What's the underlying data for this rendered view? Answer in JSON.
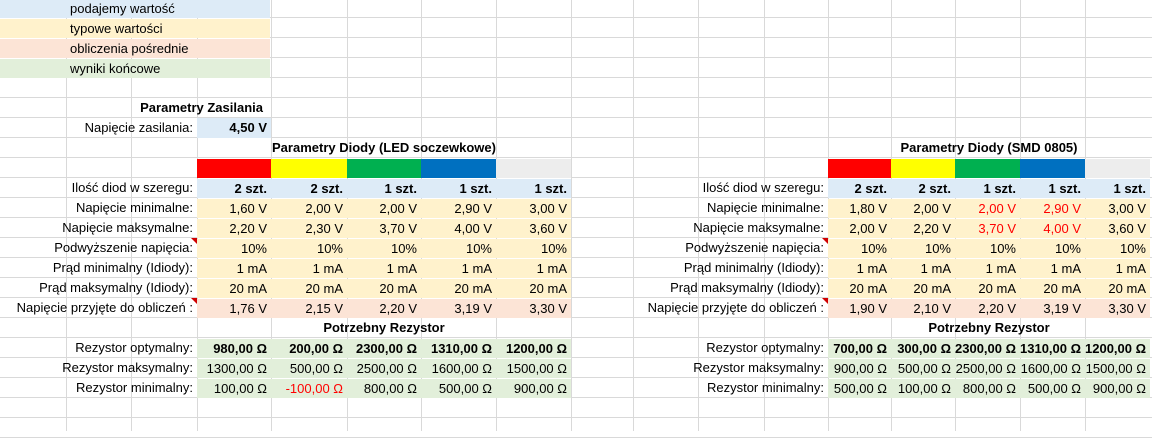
{
  "colors": {
    "input": "#ddebf7",
    "typical": "#fff2cc",
    "intermediate": "#fce4d6",
    "result": "#e2efda",
    "error_text": "#ff0000",
    "diode_swatches": [
      "#ff0000",
      "#ffff00",
      "#00b050",
      "#0070c0",
      "#ededed"
    ]
  },
  "legend": [
    {
      "label": "podajemy wartość"
    },
    {
      "label": "typowe wartości"
    },
    {
      "label": "obliczenia pośrednie"
    },
    {
      "label": "wyniki końcowe"
    }
  ],
  "power": {
    "title": "Parametry Zasilania",
    "voltage_label": "Napięcie zasilania:",
    "voltage_value": "4,50 V"
  },
  "row_labels": {
    "count": "Ilość diod w szeregu:",
    "vmin": "Napięcie minimalne:",
    "vmax": "Napięcie maksymalne:",
    "raise": "Podwyższenie napięcia:",
    "imin": "Prąd minimalny (Idiody):",
    "imax": "Prąd maksymalny (Idiody):",
    "vcalc": "Napięcie przyjęte do obliczeń :",
    "ropt": "Rezystor optymalny:",
    "rmax": "Rezystor maksymalny:",
    "rmin": "Rezystor minimalny:"
  },
  "resistor_title": "Potrzebny Rezystor",
  "tables": [
    {
      "title": "Parametry Diody (LED soczewkowe)",
      "count": [
        "2 szt.",
        "2 szt.",
        "1 szt.",
        "1 szt.",
        "1 szt."
      ],
      "vmin": [
        "1,60 V",
        "2,00 V",
        "2,00 V",
        "2,90 V",
        "3,00 V"
      ],
      "vmax": [
        "2,20 V",
        "2,30 V",
        "3,70 V",
        "4,00 V",
        "3,60 V"
      ],
      "raise": [
        "10%",
        "10%",
        "10%",
        "10%",
        "10%"
      ],
      "imin": [
        "1 mA",
        "1 mA",
        "1 mA",
        "1 mA",
        "1 mA"
      ],
      "imax": [
        "20 mA",
        "20 mA",
        "20 mA",
        "20 mA",
        "20 mA"
      ],
      "vcalc": [
        "1,76 V",
        "2,15 V",
        "2,20 V",
        "3,19 V",
        "3,30 V"
      ],
      "ropt": [
        "980,00 Ω",
        "200,00 Ω",
        "2300,00 Ω",
        "1310,00 Ω",
        "1200,00 Ω"
      ],
      "rmax": [
        "1300,00 Ω",
        "500,00 Ω",
        "2500,00 Ω",
        "1600,00 Ω",
        "1500,00 Ω"
      ],
      "rmin": [
        "100,00 Ω",
        "-100,00 Ω",
        "800,00 Ω",
        "500,00 Ω",
        "900,00 Ω"
      ]
    },
    {
      "title": "Parametry Diody (SMD 0805)",
      "count": [
        "2 szt.",
        "2 szt.",
        "1 szt.",
        "1 szt.",
        "1 szt."
      ],
      "vmin": [
        "1,80 V",
        "2,00 V",
        "2,00 V",
        "2,90 V",
        "3,00 V"
      ],
      "vmax": [
        "2,00 V",
        "2,20 V",
        "3,70 V",
        "4,00 V",
        "3,60 V"
      ],
      "raise": [
        "10%",
        "10%",
        "10%",
        "10%",
        "10%"
      ],
      "imin": [
        "1 mA",
        "1 mA",
        "1 mA",
        "1 mA",
        "1 mA"
      ],
      "imax": [
        "20 mA",
        "20 mA",
        "20 mA",
        "20 mA",
        "20 mA"
      ],
      "vcalc": [
        "1,90 V",
        "2,10 V",
        "2,20 V",
        "3,19 V",
        "3,30 V"
      ],
      "ropt": [
        "700,00 Ω",
        "300,00 Ω",
        "2300,00 Ω",
        "1310,00 Ω",
        "1200,00 Ω"
      ],
      "rmax": [
        "900,00 Ω",
        "500,00 Ω",
        "2500,00 Ω",
        "1600,00 Ω",
        "1500,00 Ω"
      ],
      "rmin": [
        "500,00 Ω",
        "100,00 Ω",
        "800,00 Ω",
        "500,00 Ω",
        "900,00 Ω"
      ]
    }
  ]
}
